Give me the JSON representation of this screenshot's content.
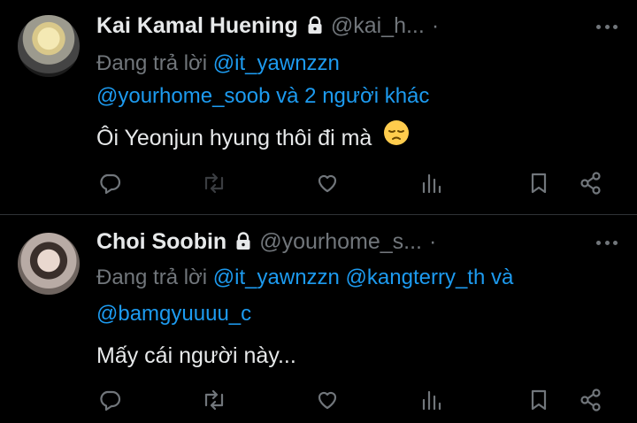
{
  "colors": {
    "background": "#000000",
    "text": "#e7e9ea",
    "muted": "#71767b",
    "link": "#1d9bf0",
    "divider": "#2f3336"
  },
  "tweets": [
    {
      "name": "Kai Kamal Huening",
      "handle": "@kai_h...",
      "dot": "·",
      "reply_prefix": "Đang trả lời",
      "reply_line1_mentions": "@it_yawnzzn",
      "reply_line2_mention": "@yourhome_soob",
      "reply_line2_suffix": "và 2 người khác",
      "text": "Ôi Yeonjun hyung thôi đi mà",
      "emoji": "pensive-face",
      "icons": [
        "reply-icon",
        "retweet-icon",
        "like-icon",
        "views-icon",
        "bookmark-icon",
        "share-icon"
      ]
    },
    {
      "name": "Choi Soobin",
      "handle": "@yourhome_s...",
      "dot": "·",
      "reply_prefix": "Đang trả lời",
      "reply_line1_mentions": "@it_yawnzzn @kangterry_th",
      "reply_line1_suffix": "và",
      "reply_line2_mention": "@bamgyuuuu_c",
      "text": "Mấy cái người này...",
      "icons": [
        "reply-icon",
        "retweet-icon",
        "like-icon",
        "views-icon",
        "bookmark-icon",
        "share-icon"
      ]
    }
  ]
}
